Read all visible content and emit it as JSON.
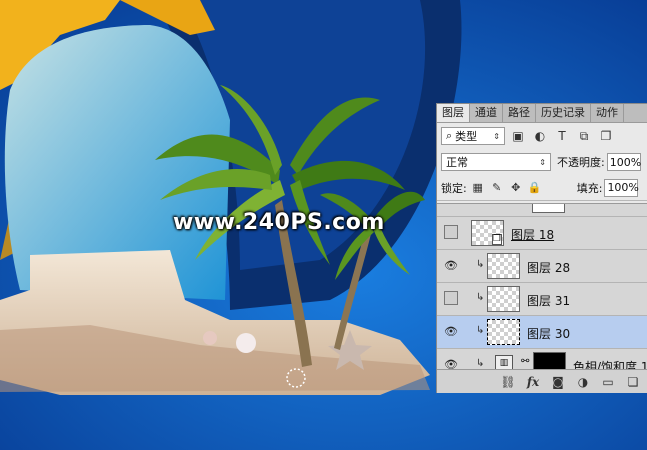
{
  "canvas": {
    "watermark": "www.240PS.com",
    "colors": {
      "sky": "#0b5fc4",
      "sand": "#e8d8c4",
      "palm": "#4f8a1c",
      "gold": "#f2b21c",
      "globe": "#0a2f6e"
    }
  },
  "panel": {
    "tabs": [
      {
        "label": "图层",
        "active": true
      },
      {
        "label": "通道",
        "active": false
      },
      {
        "label": "路径",
        "active": false
      },
      {
        "label": "历史记录",
        "active": false
      },
      {
        "label": "动作",
        "active": false
      }
    ],
    "filter": {
      "label": "类型",
      "icon": "search-icon"
    },
    "filter_icons": [
      "image-filter-icon",
      "adjustment-filter-icon",
      "type-filter-icon",
      "shape-filter-icon",
      "smart-object-filter-icon"
    ],
    "blend_mode": "正常",
    "opacity_label": "不透明度:",
    "opacity_value": "100%",
    "lock_label": "锁定:",
    "lock_icons": [
      "lock-transparent-icon",
      "lock-pixels-icon",
      "lock-position-icon",
      "lock-all-icon"
    ],
    "fill_label": "填充:",
    "fill_value": "100%",
    "layers": [
      {
        "name": "图层 18",
        "visible": false,
        "clipped": false,
        "selected": false,
        "thumb": "smart"
      },
      {
        "name": "图层 28",
        "visible": true,
        "clipped": true,
        "selected": false,
        "thumb": "transparent"
      },
      {
        "name": "图层 31",
        "visible": false,
        "clipped": true,
        "selected": false,
        "thumb": "transparent"
      },
      {
        "name": "图层 30",
        "visible": true,
        "clipped": true,
        "selected": true,
        "thumb": "transparent"
      },
      {
        "name": "色相/饱和度 1",
        "visible": true,
        "clipped": true,
        "selected": false,
        "thumb": "adjustment"
      }
    ],
    "bottom_icons": [
      "link-layers-icon",
      "fx-icon",
      "add-mask-icon",
      "new-fill-adjustment-icon",
      "new-group-icon",
      "new-layer-icon"
    ],
    "fx_label": "fx"
  }
}
